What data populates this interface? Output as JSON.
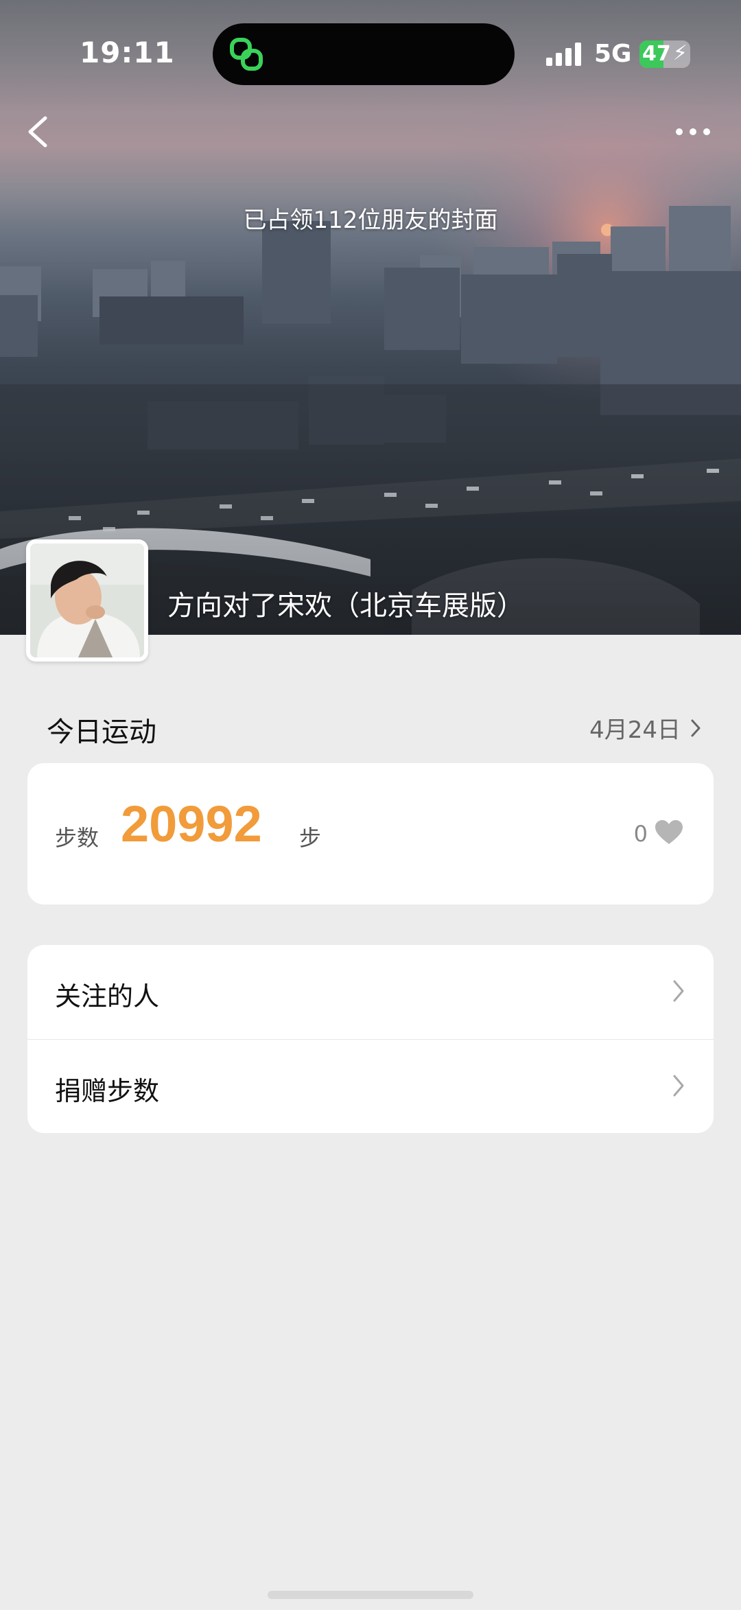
{
  "status_bar": {
    "time": "19:11",
    "network": "5G",
    "battery": "47",
    "battery_level": 0.47,
    "battery_charging": true,
    "island_icon": "linked-rings-icon"
  },
  "header": {
    "back_icon": "chevron-left-icon",
    "more_icon": "more-dots-icon",
    "cover_text": "已占领112位朋友的封面"
  },
  "profile": {
    "nickname": "方向对了宋欢（北京车展版）",
    "avatar_icon": "user-avatar"
  },
  "today": {
    "title": "今日运动",
    "date": "4月24日",
    "steps_label": "步数",
    "steps_value": "20992",
    "steps_unit": "步",
    "likes": "0",
    "like_icon": "heart-icon"
  },
  "menu": {
    "items": [
      {
        "label": "关注的人"
      },
      {
        "label": "捐赠步数"
      }
    ]
  },
  "colors": {
    "accent": "#f19b3a",
    "background": "#ececec",
    "card": "#ffffff",
    "battery_green": "#3cc85a"
  }
}
